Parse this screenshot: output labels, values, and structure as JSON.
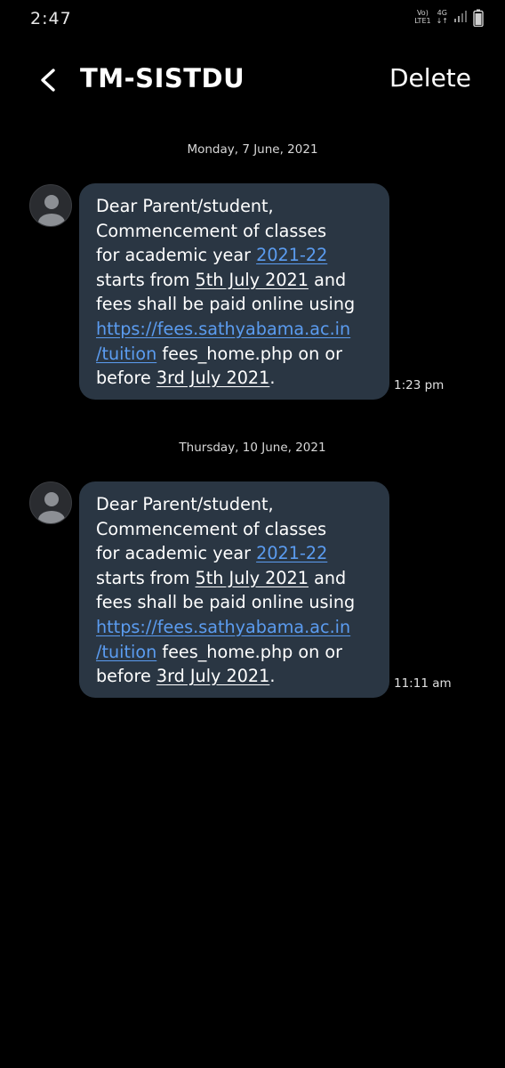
{
  "status_bar": {
    "time": "2:47",
    "volte": "Vo)",
    "lte": "LTE1",
    "network": "4G",
    "arrows": "↓↑"
  },
  "header": {
    "title": "TM-SISTDU",
    "delete_label": "Delete"
  },
  "messages": [
    {
      "date": "Monday, 7 June, 2021",
      "time": "1:23 pm",
      "lines": [
        [
          "Dear Parent/student,"
        ],
        [
          "Commencement of classes"
        ],
        [
          "for academic year ",
          "2021-22"
        ],
        [
          "starts from ",
          "5th July 2021",
          " and"
        ],
        [
          "fees shall be paid online using"
        ],
        [
          "https://fees.sathyabama.ac.in"
        ],
        [
          "/tuition",
          " fees_home.php on or"
        ],
        [
          "before ",
          "3rd July 2021",
          "."
        ]
      ]
    },
    {
      "date": "Thursday, 10 June, 2021",
      "time": "11:11 am",
      "lines": [
        [
          "Dear Parent/student,"
        ],
        [
          "Commencement of classes"
        ],
        [
          "for academic year ",
          "2021-22"
        ],
        [
          "starts from ",
          "5th July 2021",
          " and"
        ],
        [
          "fees shall be paid online using"
        ],
        [
          "https://fees.sathyabama.ac.in"
        ],
        [
          "/tuition",
          " fees_home.php on or"
        ],
        [
          "before ",
          "3rd July 2021",
          "."
        ]
      ]
    }
  ]
}
